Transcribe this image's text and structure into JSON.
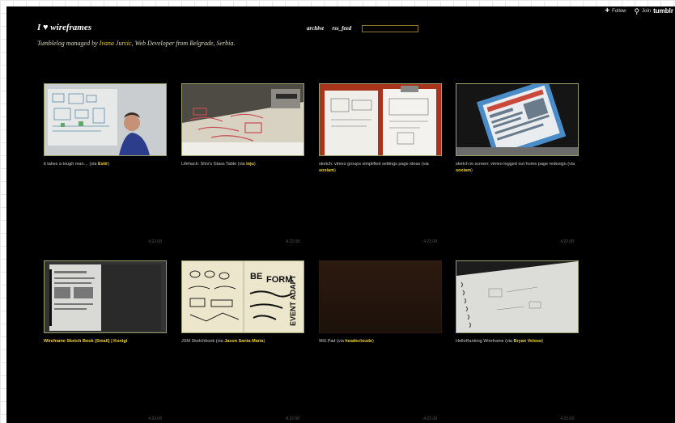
{
  "topbar": {
    "follow": "Follow",
    "join": "Join",
    "brand": "tumblr"
  },
  "header": {
    "title": "I ♥ wireframes",
    "subtitle_prefix": "Tumblelog managed by ",
    "author": "Ivana Jurcic",
    "subtitle_suffix": ", Web Developer from Belgrade, Serbia."
  },
  "nav": {
    "archive": "archive",
    "rss": "rss_feed"
  },
  "posts": [
    {
      "caption": "it takes a tough man… (via ",
      "src": "Estir",
      "after": ")",
      "date": "4.22.08"
    },
    {
      "caption": "Lifehack: Shiv's Glass Table (via ",
      "src": "inju",
      "after": ")",
      "date": "4.22.08"
    },
    {
      "caption": "sketch: vimeo groups simplified settings page ideas (via ",
      "src": "soxiam",
      "after": ")",
      "date": "4.22.08"
    },
    {
      "caption": "sketch to screen: vimeo logged out home page redesign (via ",
      "src": "soxiam",
      "after": ")",
      "date": "4.22.08"
    },
    {
      "caption": "",
      "gold": "Wireframe Sketch Book (Small) | Konigi",
      "src": "",
      "after": "",
      "date": "4.22.08"
    },
    {
      "caption": "JSM Sketchbook (via ",
      "src": "Jason Santa Maria",
      "after": ")",
      "date": "4.22.08"
    },
    {
      "caption": "960.Pad (via ",
      "src": "headecloude",
      "after": ")",
      "date": "4.22.08"
    },
    {
      "caption": "HelloRanking Wireframe (via ",
      "src": "Bryan Veloso",
      "after": ")",
      "date": "4.22.08"
    }
  ]
}
